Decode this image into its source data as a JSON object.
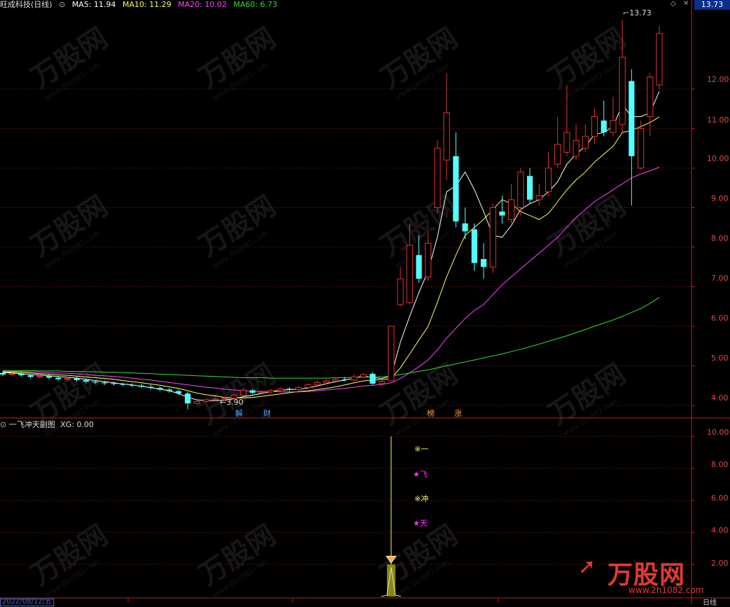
{
  "header": {
    "title": "旺成科技(日线)",
    "ma_labels": [
      {
        "text": "MA5: 11.94",
        "color": "#ffffff"
      },
      {
        "text": "MA10: 11.29",
        "color": "#ffff55"
      },
      {
        "text": "MA20: 10.02",
        "color": "#ff44ff"
      },
      {
        "text": "MA60: 6.73",
        "color": "#33dd33"
      }
    ],
    "current_price": "13.73"
  },
  "price_axis": [
    "12.00",
    "11.00",
    "10.00",
    "9.00",
    "8.00",
    "7.00",
    "6.00",
    "5.00",
    "4.00"
  ],
  "annotations": {
    "high": "13.73",
    "low": "3.90"
  },
  "events": [
    {
      "label": "解",
      "color": "#55aaff"
    },
    {
      "label": "财",
      "color": "#55aaff"
    },
    {
      "label": "榜",
      "color": "#ff9933"
    },
    {
      "label": "涨",
      "color": "#ff9933"
    }
  ],
  "indicator": {
    "title": "一飞冲天副图",
    "value": "XG: 0.00",
    "axis": [
      "10.00",
      "8.00",
      "6.00",
      "4.00",
      "2.00"
    ],
    "signals": [
      {
        "text": "※一",
        "color": "#ffff66"
      },
      {
        "text": "★飞",
        "color": "#ff33ff"
      },
      {
        "text": "※冲",
        "color": "#ffff66"
      },
      {
        "text": "★天",
        "color": "#ff33ff"
      }
    ]
  },
  "bottom": {
    "date": "2022/08/12/五",
    "period": "日线"
  },
  "watermark": {
    "brand": "万股网",
    "url": "www.2h1082.com",
    "logo_url": "www.2h1082.com"
  },
  "chart_data": {
    "type": "candlestick",
    "ylim": [
      3.7,
      14.0
    ],
    "candles": [
      {
        "o": 4.82,
        "c": 4.78,
        "h": 4.86,
        "l": 4.74
      },
      {
        "o": 4.78,
        "c": 4.8,
        "h": 4.84,
        "l": 4.74
      },
      {
        "o": 4.8,
        "c": 4.76,
        "h": 4.84,
        "l": 4.72
      },
      {
        "o": 4.76,
        "c": 4.72,
        "h": 4.8,
        "l": 4.68
      },
      {
        "o": 4.72,
        "c": 4.74,
        "h": 4.78,
        "l": 4.68
      },
      {
        "o": 4.74,
        "c": 4.7,
        "h": 4.78,
        "l": 4.66
      },
      {
        "o": 4.7,
        "c": 4.66,
        "h": 4.74,
        "l": 4.62
      },
      {
        "o": 4.66,
        "c": 4.68,
        "h": 4.72,
        "l": 4.62
      },
      {
        "o": 4.68,
        "c": 4.64,
        "h": 4.72,
        "l": 4.6
      },
      {
        "o": 4.64,
        "c": 4.6,
        "h": 4.68,
        "l": 4.55
      },
      {
        "o": 4.6,
        "c": 4.58,
        "h": 4.64,
        "l": 4.54
      },
      {
        "o": 4.58,
        "c": 4.56,
        "h": 4.62,
        "l": 4.52
      },
      {
        "o": 4.56,
        "c": 4.54,
        "h": 4.6,
        "l": 4.5
      },
      {
        "o": 4.54,
        "c": 4.52,
        "h": 4.58,
        "l": 4.48
      },
      {
        "o": 4.52,
        "c": 4.5,
        "h": 4.56,
        "l": 4.46
      },
      {
        "o": 4.5,
        "c": 4.47,
        "h": 4.55,
        "l": 4.44
      },
      {
        "o": 4.47,
        "c": 4.44,
        "h": 4.52,
        "l": 4.4
      },
      {
        "o": 4.44,
        "c": 4.4,
        "h": 4.48,
        "l": 4.36
      },
      {
        "o": 4.4,
        "c": 4.36,
        "h": 4.44,
        "l": 4.32
      },
      {
        "o": 4.36,
        "c": 4.3,
        "h": 4.4,
        "l": 4.26
      },
      {
        "o": 4.3,
        "c": 4.05,
        "h": 4.34,
        "l": 3.9
      },
      {
        "o": 4.05,
        "c": 4.1,
        "h": 4.14,
        "l": 4.02
      },
      {
        "o": 4.1,
        "c": 4.14,
        "h": 4.18,
        "l": 4.06
      },
      {
        "o": 4.14,
        "c": 4.16,
        "h": 4.22,
        "l": 4.1
      },
      {
        "o": 4.16,
        "c": 4.18,
        "h": 4.22,
        "l": 4.12
      },
      {
        "o": 4.18,
        "c": 4.26,
        "h": 4.3,
        "l": 4.15
      },
      {
        "o": 4.26,
        "c": 4.38,
        "h": 4.42,
        "l": 4.22
      },
      {
        "o": 4.38,
        "c": 4.32,
        "h": 4.42,
        "l": 4.28
      },
      {
        "o": 4.32,
        "c": 4.34,
        "h": 4.38,
        "l": 4.28
      },
      {
        "o": 4.34,
        "c": 4.38,
        "h": 4.42,
        "l": 4.3
      },
      {
        "o": 4.38,
        "c": 4.42,
        "h": 4.46,
        "l": 4.34
      },
      {
        "o": 4.42,
        "c": 4.4,
        "h": 4.46,
        "l": 4.36
      },
      {
        "o": 4.4,
        "c": 4.45,
        "h": 4.5,
        "l": 4.37
      },
      {
        "o": 4.45,
        "c": 4.52,
        "h": 4.56,
        "l": 4.42
      },
      {
        "o": 4.52,
        "c": 4.58,
        "h": 4.64,
        "l": 4.48
      },
      {
        "o": 4.58,
        "c": 4.62,
        "h": 4.66,
        "l": 4.54
      },
      {
        "o": 4.62,
        "c": 4.66,
        "h": 4.7,
        "l": 4.58
      },
      {
        "o": 4.66,
        "c": 4.64,
        "h": 4.72,
        "l": 4.6
      },
      {
        "o": 4.64,
        "c": 4.72,
        "h": 4.78,
        "l": 4.62
      },
      {
        "o": 4.72,
        "c": 4.78,
        "h": 4.82,
        "l": 4.7
      },
      {
        "o": 4.8,
        "c": 4.55,
        "h": 4.84,
        "l": 4.52
      },
      {
        "o": 4.55,
        "c": 4.6,
        "h": 4.66,
        "l": 4.5
      },
      {
        "o": 4.62,
        "c": 6.0,
        "h": 6.0,
        "l": 4.6
      },
      {
        "o": 6.55,
        "c": 7.2,
        "h": 7.5,
        "l": 6.5
      },
      {
        "o": 6.6,
        "c": 8.05,
        "h": 8.6,
        "l": 6.55
      },
      {
        "o": 7.8,
        "c": 7.2,
        "h": 8.3,
        "l": 7.1
      },
      {
        "o": 7.25,
        "c": 8.1,
        "h": 8.4,
        "l": 7.15
      },
      {
        "o": 9.0,
        "c": 10.5,
        "h": 10.7,
        "l": 8.85
      },
      {
        "o": 10.2,
        "c": 11.4,
        "h": 12.4,
        "l": 9.7
      },
      {
        "o": 10.3,
        "c": 8.65,
        "h": 10.9,
        "l": 8.5
      },
      {
        "o": 8.6,
        "c": 8.4,
        "h": 9.0,
        "l": 8.2
      },
      {
        "o": 8.45,
        "c": 7.6,
        "h": 8.6,
        "l": 7.4
      },
      {
        "o": 7.7,
        "c": 7.5,
        "h": 8.1,
        "l": 7.2
      },
      {
        "o": 7.5,
        "c": 9.0,
        "h": 9.1,
        "l": 7.35
      },
      {
        "o": 8.9,
        "c": 8.8,
        "h": 9.3,
        "l": 8.6
      },
      {
        "o": 8.7,
        "c": 9.2,
        "h": 9.6,
        "l": 8.6
      },
      {
        "o": 9.0,
        "c": 9.9,
        "h": 10.0,
        "l": 8.8
      },
      {
        "o": 9.8,
        "c": 9.2,
        "h": 10.0,
        "l": 9.1
      },
      {
        "o": 9.2,
        "c": 9.3,
        "h": 9.6,
        "l": 9.05
      },
      {
        "o": 9.4,
        "c": 10.0,
        "h": 10.4,
        "l": 9.3
      },
      {
        "o": 10.1,
        "c": 10.6,
        "h": 11.3,
        "l": 10.0
      },
      {
        "o": 10.4,
        "c": 10.9,
        "h": 12.1,
        "l": 10.3
      },
      {
        "o": 10.3,
        "c": 10.7,
        "h": 11.1,
        "l": 10.2
      },
      {
        "o": 10.5,
        "c": 10.8,
        "h": 11.1,
        "l": 10.4
      },
      {
        "o": 10.8,
        "c": 11.3,
        "h": 11.5,
        "l": 10.6
      },
      {
        "o": 11.2,
        "c": 10.9,
        "h": 11.7,
        "l": 10.8
      },
      {
        "o": 10.9,
        "c": 11.2,
        "h": 11.8,
        "l": 10.8
      },
      {
        "o": 11.1,
        "c": 12.8,
        "h": 13.73,
        "l": 10.9
      },
      {
        "o": 12.2,
        "c": 10.3,
        "h": 12.5,
        "l": 9.05
      },
      {
        "o": 10.0,
        "c": 11.0,
        "h": 11.2,
        "l": 9.95
      },
      {
        "o": 11.3,
        "c": 12.3,
        "h": 12.4,
        "l": 10.8
      },
      {
        "o": 12.1,
        "c": 13.4,
        "h": 13.6,
        "l": 12.0
      }
    ],
    "ma_series": [
      {
        "name": "MA5",
        "values": [
          4.83,
          4.82,
          4.8,
          4.78,
          4.77,
          4.75,
          4.73,
          4.71,
          4.69,
          4.66,
          4.63,
          4.6,
          4.57,
          4.54,
          4.52,
          4.48,
          4.45,
          4.41,
          4.37,
          4.3,
          4.2,
          4.14,
          4.12,
          4.12,
          4.13,
          4.17,
          4.22,
          4.26,
          4.3,
          4.35,
          4.38,
          4.4,
          4.41,
          4.44,
          4.49,
          4.55,
          4.6,
          4.64,
          4.69,
          4.75,
          4.7,
          4.68,
          4.75,
          5.6,
          6.25,
          6.85,
          7.4,
          8.25,
          9.4,
          9.55,
          9.9,
          9.45,
          8.9,
          8.3,
          8.25,
          8.55,
          8.95,
          9.1,
          9.2,
          9.4,
          9.65,
          10.1,
          10.35,
          10.55,
          10.85,
          10.9,
          11.05,
          11.6,
          11.3,
          11.3,
          11.4,
          11.94
        ]
      },
      {
        "name": "MA10",
        "values": [
          4.85,
          4.84,
          4.83,
          4.82,
          4.8,
          4.79,
          4.77,
          4.76,
          4.74,
          4.72,
          4.7,
          4.68,
          4.66,
          4.63,
          4.6,
          4.57,
          4.54,
          4.51,
          4.47,
          4.43,
          4.37,
          4.31,
          4.27,
          4.24,
          4.2,
          4.19,
          4.19,
          4.2,
          4.23,
          4.26,
          4.29,
          4.32,
          4.35,
          4.37,
          4.4,
          4.43,
          4.47,
          4.52,
          4.57,
          4.62,
          4.64,
          4.65,
          4.68,
          4.95,
          5.3,
          5.65,
          6.0,
          6.6,
          7.25,
          7.8,
          8.3,
          8.5,
          8.7,
          8.95,
          9.2,
          9.1,
          8.9,
          8.8,
          8.7,
          8.85,
          9.15,
          9.45,
          9.7,
          9.9,
          10.15,
          10.35,
          10.55,
          10.9,
          10.95,
          11.05,
          11.15,
          11.29
        ]
      },
      {
        "name": "MA20",
        "values": [
          4.87,
          4.86,
          4.86,
          4.85,
          4.84,
          4.83,
          4.82,
          4.81,
          4.8,
          4.78,
          4.76,
          4.75,
          4.73,
          4.71,
          4.69,
          4.66,
          4.64,
          4.61,
          4.58,
          4.55,
          4.52,
          4.49,
          4.46,
          4.44,
          4.41,
          4.39,
          4.37,
          4.36,
          4.35,
          4.35,
          4.34,
          4.34,
          4.34,
          4.35,
          4.37,
          4.39,
          4.41,
          4.43,
          4.46,
          4.49,
          4.51,
          4.53,
          4.57,
          4.68,
          4.82,
          4.98,
          5.15,
          5.4,
          5.7,
          5.95,
          6.2,
          6.4,
          6.55,
          6.8,
          7.05,
          7.25,
          7.45,
          7.65,
          7.85,
          8.05,
          8.25,
          8.5,
          8.75,
          8.95,
          9.15,
          9.3,
          9.45,
          9.6,
          9.75,
          9.85,
          9.93,
          10.02
        ]
      },
      {
        "name": "MA60",
        "values": [
          4.88,
          4.88,
          4.88,
          4.88,
          4.87,
          4.87,
          4.87,
          4.86,
          4.86,
          4.85,
          4.85,
          4.84,
          4.84,
          4.83,
          4.82,
          4.81,
          4.8,
          4.79,
          4.78,
          4.77,
          4.76,
          4.75,
          4.74,
          4.73,
          4.72,
          4.71,
          4.7,
          4.7,
          4.7,
          4.69,
          4.69,
          4.69,
          4.69,
          4.69,
          4.69,
          4.69,
          4.7,
          4.7,
          4.71,
          4.71,
          4.72,
          4.72,
          4.74,
          4.78,
          4.82,
          4.86,
          4.9,
          4.95,
          5.0,
          5.05,
          5.1,
          5.15,
          5.2,
          5.25,
          5.3,
          5.36,
          5.42,
          5.48,
          5.55,
          5.62,
          5.69,
          5.76,
          5.84,
          5.92,
          6.0,
          6.08,
          6.16,
          6.25,
          6.35,
          6.45,
          6.58,
          6.73
        ]
      }
    ],
    "indicator_series": {
      "name": "XG",
      "ylim": [
        0,
        10.5
      ],
      "spike_index": 42,
      "spike_value": 10.0,
      "bar_value": 2.0
    }
  }
}
